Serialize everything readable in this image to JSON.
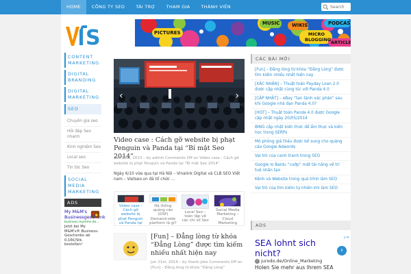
{
  "topnav": {
    "items": [
      "HOME",
      "CÔNG TY SEO",
      "TÀI TRỢ",
      "THAM GIA",
      "THÀNH VIÊN"
    ]
  },
  "search": {
    "placeholder": "Search"
  },
  "banner": {
    "tags": [
      "MUSIC",
      "WIKIS",
      "PODCASTS",
      "PICTURES",
      "MICRO BLOGGING",
      "ARTICLES"
    ]
  },
  "leftnav": {
    "items": [
      "CONTENT MARKETING",
      "DIGITAL BRANDING",
      "DIGITAL MARKETING",
      "SEO"
    ],
    "sub_items": [
      "Chuyên gia seo",
      "Hỏi đáp Seo nhanh",
      "Kinh nghiệm Seo",
      "Local seo",
      "Tin tức Seo"
    ],
    "bottom_item": "SOCIAL MEDIA MARKETING",
    "ads_label": "ADS",
    "ad": {
      "title": "My M&M's Businessgeschenk",
      "source": "business.mymms.de...",
      "text": "Jetzt bei My M&M's® Business- Geschenke ab 0,16€/Stk. bestellen!"
    }
  },
  "post1": {
    "title": "Video case : Cách gỡ website bị phạt Penguin và Panda tại “Bí mật Seo 2014”",
    "meta": "Oct 10th, 2013 – by admin Comments Off on Video case : Cách gỡ website bị phạt Penguin và Panda tại “Bí mật Seo 2014”",
    "excerpt": "Ngày 6/10 vừa qua tại Hà Nội – Vinalink Digital và CLB SEO Việt nam – Vietseo.vn đã tổ chức …"
  },
  "related": [
    "Video case : Cách gỡ website bị phạt Penguin và Panda tại",
    "Hệ thống quảng cáo (DSP) Demand-side platform là gì?",
    "Local Seo – toàn tập về các chỉ số Seo",
    "Social Media Marketing – Cloud Marketing",
    ""
  ],
  "post2": {
    "title": "[Fun] – Đẳng lòng từ khóa “Đẳng Lòng” được tìm kiếm nhiều nhất hiện nay",
    "meta": "Jun 21st, 2014 – by thanh.jobs Comments Off on [Fun] – Đẳng lòng từ khóa “Đẳng Lòng”"
  },
  "recent": {
    "heading": "CÁC BÀI MỚI",
    "items": [
      "[Fun] – Đẳng lòng từ khóa “Đẳng Lòng” được tìm kiếm nhiều nhất hiện nay",
      "[XÁC NHẬN] – Thuật toán Payday Loan 2.0 được cập nhật cùng lúc với Panda 4.0",
      "[CẬP NHẬT] – eBay “tan tành xác pháo” sau khi Google nhả đạn Panda 4.0?",
      "[HOT] – Thuật toán Panda 4.0 được Google cập nhật ngày 20/05/2014",
      "BING cập nhật kiến thức để ẩm thực và kiến học trong SERPs",
      "Mô phỏng giá thầu được bổ sung cho quảng cáo Google Adwords",
      "Vai trò của canh tranh trong SEO",
      "Google lo Baidu “cướp” mất tài năng về trí tuệ nhân tạo",
      "Kênh và Website trong quá trình làm SEO",
      "Vai trò của tìm kiếm tự nhiên khi làm SEO"
    ]
  },
  "ads_right": {
    "heading": "ADS",
    "headline": "SEA lohnt sich nicht?",
    "url": "jurodo.de/Online_Marketing",
    "line": "Holen Sie mehr aus Ihrem SEA"
  },
  "colors": {
    "brand": "#2b8fd1",
    "logo_orange": "#f39200"
  }
}
